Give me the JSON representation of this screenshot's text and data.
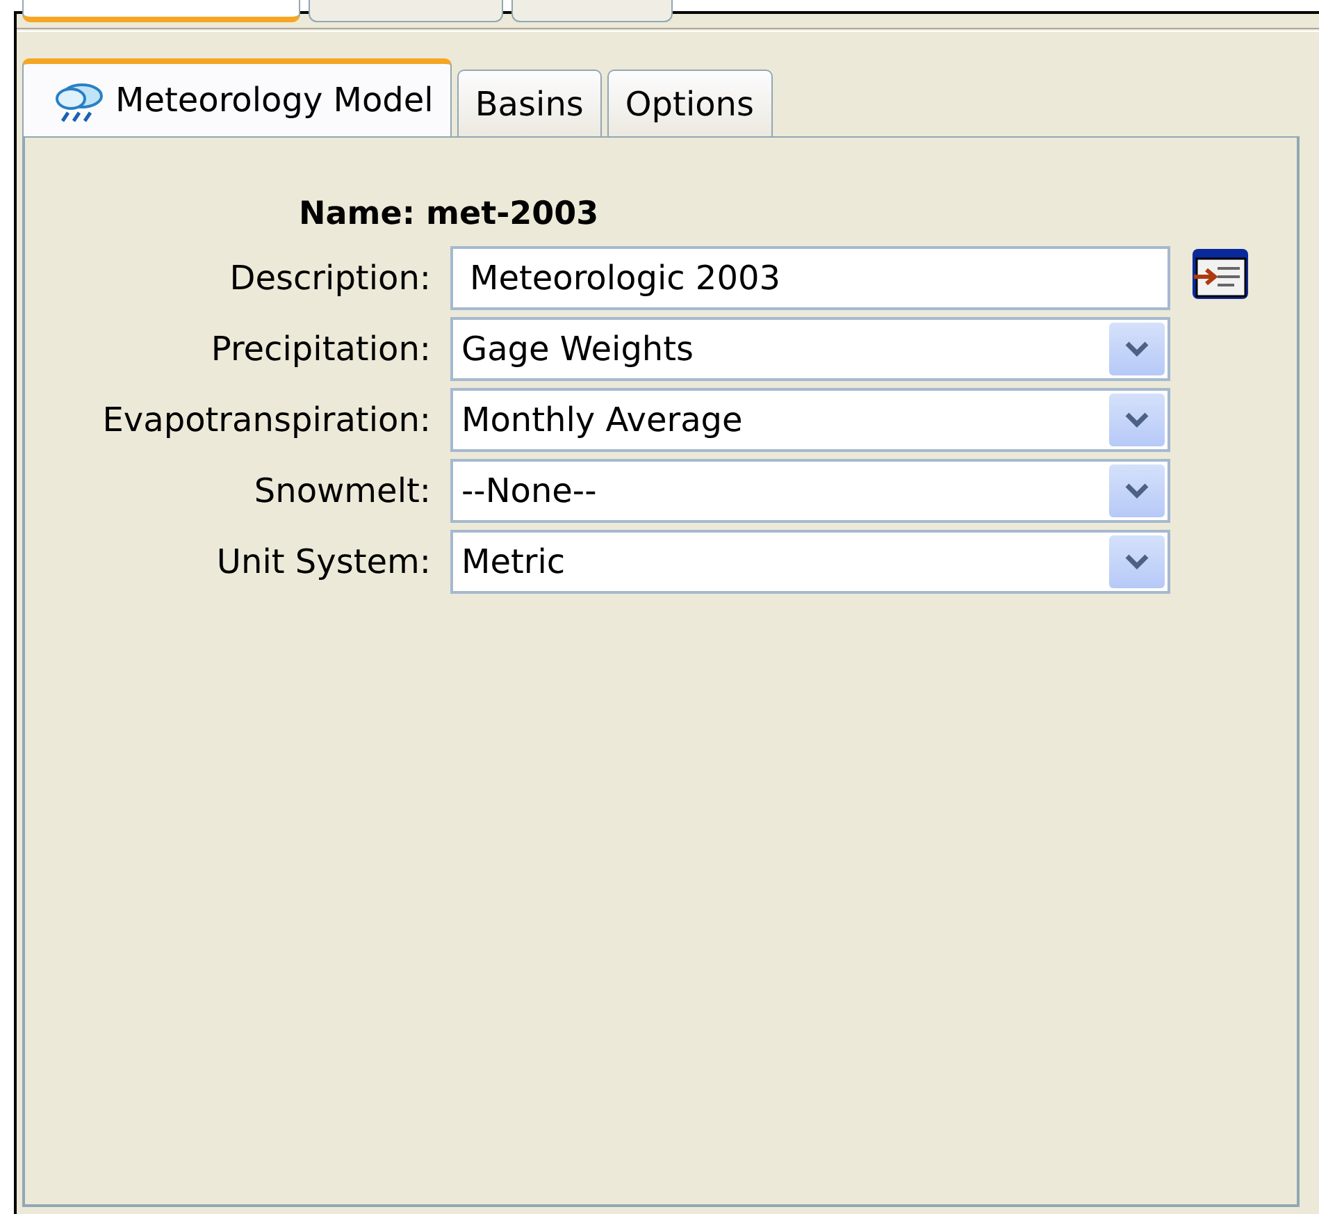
{
  "top_tabs": [
    {
      "selected": true
    },
    {
      "selected": false
    },
    {
      "selected": false
    }
  ],
  "tabs": [
    {
      "label": "Meteorology Model",
      "selected": true,
      "kind": "icon-label"
    },
    {
      "label": "Basins",
      "selected": false,
      "kind": "label"
    },
    {
      "label": "Options",
      "selected": false,
      "kind": "label"
    }
  ],
  "name": {
    "label": "Name:",
    "value": "met-2003"
  },
  "fields": [
    {
      "kind": "text",
      "label": "Description:",
      "value": "Meteorologic 2003"
    },
    {
      "kind": "dropdown",
      "label": "Precipitation:",
      "value": "Gage Weights"
    },
    {
      "kind": "dropdown",
      "label": "Evapotranspiration:",
      "value": "Monthly Average"
    },
    {
      "kind": "dropdown",
      "label": "Snowmelt:",
      "value": "--None--"
    },
    {
      "kind": "dropdown",
      "label": "Unit System:",
      "value": "Metric"
    }
  ]
}
